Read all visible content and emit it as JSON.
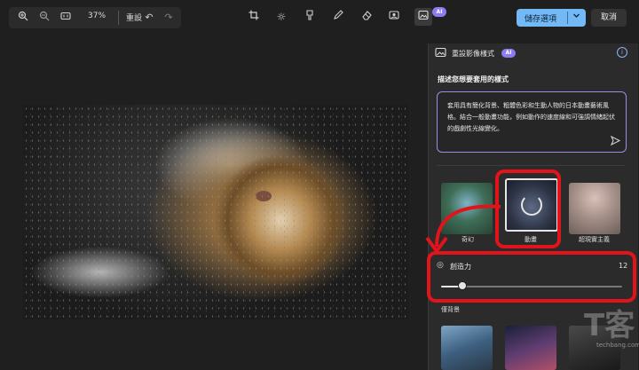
{
  "toolbar_left": {
    "zoom_in_icon": "zoom-in",
    "zoom_out_icon": "zoom-out",
    "fit_icon": "fit-to-window",
    "zoom_level": "37%",
    "reset_label": "重設",
    "undo_icon": "undo",
    "redo_icon": "redo"
  },
  "toolbar_center": {
    "tools": [
      "crop",
      "adjust",
      "retouch",
      "markup",
      "erase",
      "background",
      "restyle"
    ],
    "ai_badge": "AI"
  },
  "toolbar_right": {
    "save_label": "儲存選項",
    "cancel_label": "取消"
  },
  "panel": {
    "title": "重設影像樣式",
    "ai_badge": "AI",
    "section_header": "描述您想要套用的樣式",
    "prompt_text": "套用具有簡化背景、粗體色彩和生動人物的日本動畫藝術風格。結合一般動畫功能，例如動作的速度線和可強調情緒起伏的戲劇性光線變化。",
    "styles": [
      {
        "label": "奇幻"
      },
      {
        "label": "動畫"
      },
      {
        "label": "超現實主義"
      }
    ],
    "creativity_label": "創造力",
    "creativity_value": "12",
    "creativity_level": 0.12,
    "background_section": "僅背景"
  },
  "watermark": {
    "text": "techbang.com"
  },
  "colors": {
    "accent": "#72b9f5",
    "ai_badge": "#8b7cf0",
    "annotation": "#e0141a"
  }
}
